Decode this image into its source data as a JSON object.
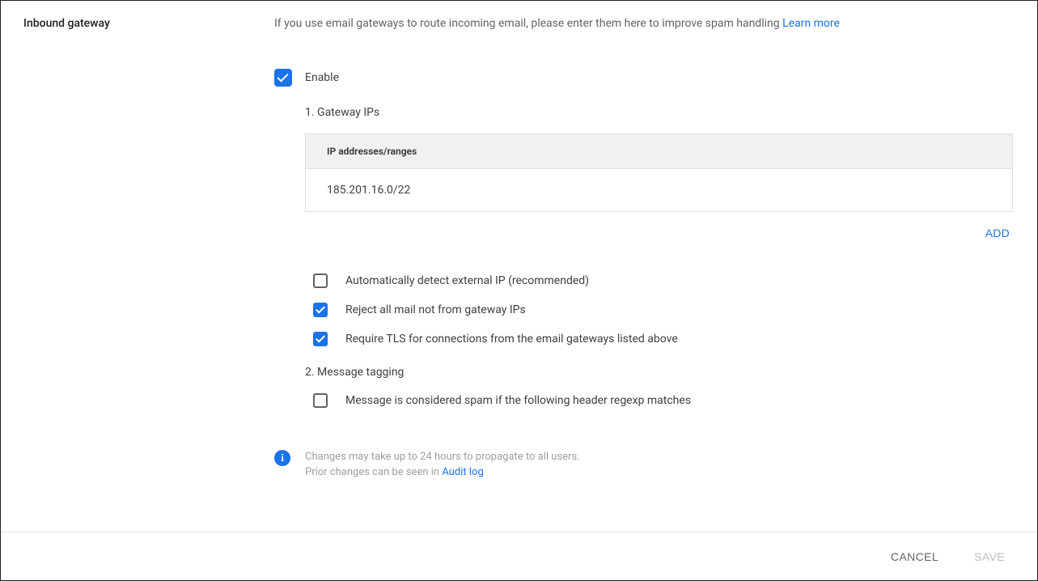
{
  "title": "Inbound gateway",
  "description": "If you use email gateways to route incoming email, please enter them here to improve spam handling ",
  "learn_more": "Learn more",
  "enable": {
    "checked": true,
    "label": "Enable"
  },
  "section1": {
    "title": "1. Gateway IPs",
    "table_header": "IP addresses/ranges",
    "rows": [
      "185.201.16.0/22"
    ],
    "add_label": "ADD"
  },
  "options": [
    {
      "checked": false,
      "label": "Automatically detect external IP (recommended)"
    },
    {
      "checked": true,
      "label": "Reject all mail not from gateway IPs"
    },
    {
      "checked": true,
      "label": "Require TLS for connections from the email gateways listed above"
    }
  ],
  "section2": {
    "title": "2. Message tagging",
    "option": {
      "checked": false,
      "label": "Message is considered spam if the following header regexp matches"
    }
  },
  "info": {
    "line1": "Changes may take up to 24 hours to propagate to all users.",
    "line2_prefix": "Prior changes can be seen in ",
    "audit_link": "Audit log"
  },
  "footer": {
    "cancel": "CANCEL",
    "save": "SAVE"
  }
}
